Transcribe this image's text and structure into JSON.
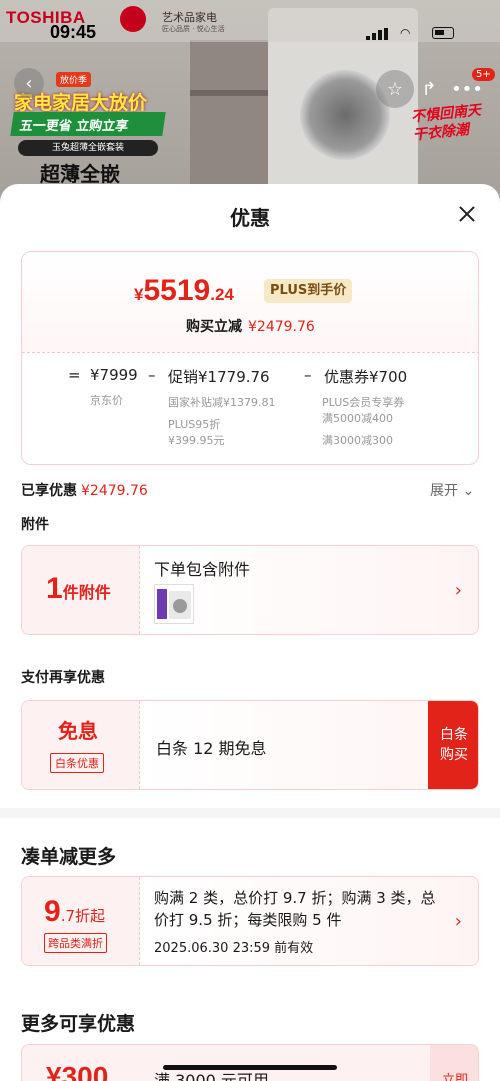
{
  "status": {
    "time": "09:45"
  },
  "background": {
    "brand": "TOSHIBA",
    "shop_name": "艺术品家电",
    "shop_sub": "匠心品质 · 悦心生活",
    "promo_badge": "放价季",
    "promo_title": "家电家居大放价",
    "promo_strip": "五一更省 立购立享",
    "promo_sub": "玉兔超薄全嵌套装",
    "promo_big": "超薄全嵌",
    "slogan_line1": "不惧回南天",
    "slogan_line2": "干衣除潮",
    "more_badge": "5+"
  },
  "sheet": {
    "title": "优惠",
    "price": {
      "currency": "¥",
      "integer": "5519",
      "decimal": ".24",
      "plus_tag": "PLUS到手价",
      "reduce_label": "购买立减",
      "reduce_amount": "¥2479.76"
    },
    "breakdown": {
      "eq_sign": "=",
      "jd_price": "¥7999",
      "jd_label": "京东价",
      "minus1": "–",
      "promo_label_main": "促销",
      "promo_amount": "¥1779.76",
      "promo_detail1": "国家补贴减¥1379.81",
      "promo_detail2": "PLUS95折",
      "promo_detail3": "¥399.95元",
      "minus2": "–",
      "coupon_label_main": "优惠券",
      "coupon_amount": "¥700",
      "coupon_detail1": "PLUS会员专享券",
      "coupon_detail2": "满5000减400",
      "coupon_detail3": "满3000减300"
    },
    "enjoyed": {
      "label": "已享优惠",
      "amount": "¥2479.76",
      "expand": "展开"
    },
    "accessory": {
      "section": "附件",
      "count": "1",
      "unit": "件附件",
      "title": "下单包含附件"
    },
    "payment": {
      "section": "支付再享优惠",
      "free_label": "免息",
      "tag": "白条优惠",
      "text": "白条 12 期免息",
      "button_line1": "白条",
      "button_line2": "购买"
    },
    "discount": {
      "section": "凑单减更多",
      "num": "9",
      "unit": ".7折起",
      "tag": "跨品类满折",
      "text": "购满 2 类，总价打 9.7 折；购满 3 类，总价打 9.5 折；每类限购 5 件",
      "date": "2025.06.30 23:59 前有效"
    },
    "more": {
      "section": "更多可享优惠",
      "amount": "¥300",
      "text": "满 3000 元可用",
      "button": "立即"
    }
  },
  "colors": {
    "accent": "#e2231a",
    "plus_gold": "#7a4d12"
  }
}
